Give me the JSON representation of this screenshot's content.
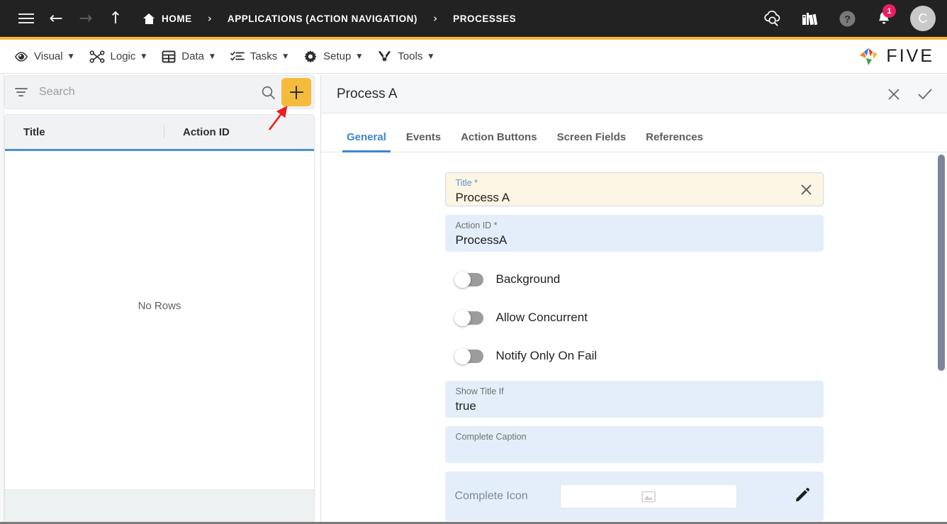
{
  "topbar": {
    "nav_icons": [
      {
        "name": "menu-icon",
        "label": "Menu"
      },
      {
        "name": "back-arrow-icon",
        "label": "←"
      },
      {
        "name": "forward-arrow-icon",
        "label": "→"
      },
      {
        "name": "up-arrow-icon",
        "label": "↑"
      }
    ],
    "breadcrumbs": [
      {
        "label": "HOME",
        "icon": "home-icon"
      },
      {
        "label": "APPLICATIONS (ACTION NAVIGATION)",
        "icon": ""
      },
      {
        "label": "PROCESSES",
        "icon": ""
      }
    ],
    "separator": "›",
    "right_icons": [
      {
        "name": "cloud-search-icon"
      },
      {
        "name": "books-icon"
      },
      {
        "name": "help-icon"
      },
      {
        "name": "notifications-bell-icon"
      }
    ],
    "notification_count": "1",
    "avatar_initial": "C",
    "background": "#222222",
    "accent": "#f5b731"
  },
  "menubar": {
    "items": [
      {
        "label": "Visual",
        "icon": "eye-icon"
      },
      {
        "label": "Logic",
        "icon": "logic-nodes-icon"
      },
      {
        "label": "Data",
        "icon": "table-icon"
      },
      {
        "label": "Tasks",
        "icon": "checklist-icon"
      },
      {
        "label": "Setup",
        "icon": "gear-icon"
      },
      {
        "label": "Tools",
        "icon": "tools-icon"
      }
    ],
    "caret": "▼",
    "brand": "FIVE"
  },
  "left_panel": {
    "search": {
      "placeholder": "Search",
      "value": "",
      "filter_icon": "filter-icon",
      "search_icon": "search-icon"
    },
    "add_button": {
      "label": "+",
      "color": "#f5bb3c"
    },
    "grid": {
      "columns": [
        "Title",
        "Action ID"
      ],
      "rows": [],
      "empty_text": "No Rows"
    }
  },
  "right_panel": {
    "title": "Process A",
    "header_actions": [
      {
        "name": "close-icon",
        "label": "✕"
      },
      {
        "name": "confirm-check-icon",
        "label": "✓"
      }
    ],
    "tabs": [
      {
        "label": "General",
        "active": true
      },
      {
        "label": "Events",
        "active": false
      },
      {
        "label": "Action Buttons",
        "active": false
      },
      {
        "label": "Screen Fields",
        "active": false
      },
      {
        "label": "References",
        "active": false
      }
    ],
    "fields": {
      "title": {
        "label": "Title *",
        "value": "Process A",
        "clear_icon": "clear-icon"
      },
      "action_id": {
        "label": "Action ID *",
        "value": "ProcessA"
      },
      "show_title_if": {
        "label": "Show Title If",
        "value": "true"
      },
      "complete_caption": {
        "label": "Complete Caption",
        "value": ""
      },
      "complete_icon": {
        "label": "Complete Icon",
        "value": "",
        "placeholder_icon": "image-placeholder-icon",
        "edit_icon": "pencil-icon"
      }
    },
    "toggles": [
      {
        "label": "Background",
        "on": false
      },
      {
        "label": "Allow Concurrent",
        "on": false
      },
      {
        "label": "Notify Only On Fail",
        "on": false
      }
    ]
  },
  "annotation": {
    "arrow_color": "#ee1c1c",
    "points_to": "add-button"
  }
}
